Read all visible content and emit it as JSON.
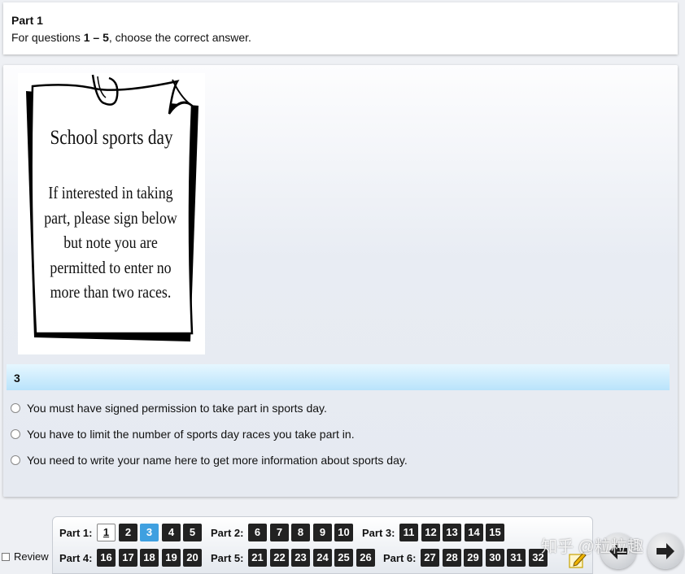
{
  "header": {
    "title": "Part 1",
    "instruction_prefix": "For questions ",
    "instruction_range": "1 – 5",
    "instruction_suffix": ", choose the correct answer."
  },
  "poster": {
    "title": "School sports day",
    "lines": [
      "If interested in taking",
      "part, please sign below",
      "but note you are",
      "permitted to enter no",
      "more than two races."
    ]
  },
  "question": {
    "number": "3",
    "options": [
      "You must have signed permission to take part in sports day.",
      "You have to limit the number of sports day races you take part in.",
      "You need to write your name here to get more information about sports day."
    ]
  },
  "review_label": "Review",
  "navigation": {
    "parts": [
      {
        "label": "Part 1:",
        "questions": [
          "1",
          "2",
          "3",
          "4",
          "5"
        ]
      },
      {
        "label": "Part 2:",
        "questions": [
          "6",
          "7",
          "8",
          "9",
          "10"
        ]
      },
      {
        "label": "Part 3:",
        "questions": [
          "11",
          "12",
          "13",
          "14",
          "15"
        ]
      },
      {
        "label": "Part 4:",
        "questions": [
          "16",
          "17",
          "18",
          "19",
          "20"
        ]
      },
      {
        "label": "Part 5:",
        "questions": [
          "21",
          "22",
          "23",
          "24",
          "25",
          "26"
        ]
      },
      {
        "label": "Part 6:",
        "questions": [
          "27",
          "28",
          "29",
          "30",
          "31",
          "32"
        ]
      }
    ],
    "current_question": "1",
    "active_question": "3"
  },
  "icons": {
    "pencil": "pencil-note-icon",
    "prev": "arrow-left-icon",
    "next": "arrow-right-icon"
  },
  "watermark": "知乎 @粒粒趣",
  "colors": {
    "active_button": "#3fa0e0",
    "question_button": "#222222",
    "question_bar": "#b9e3fb"
  }
}
